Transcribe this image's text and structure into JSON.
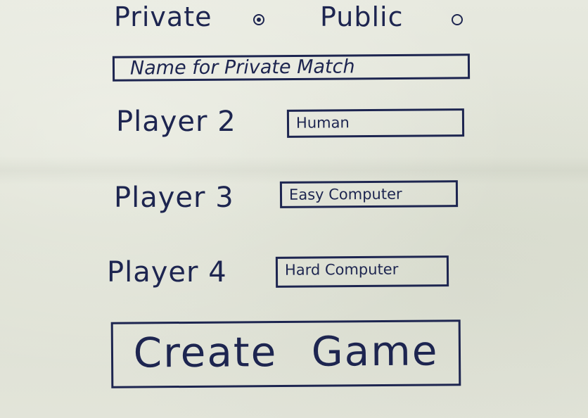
{
  "visibility": {
    "private_label": "Private",
    "public_label": "Public",
    "selected": "private"
  },
  "match_name": {
    "placeholder": "Name for Private Match"
  },
  "players": [
    {
      "label": "Player 2",
      "selection": "Human"
    },
    {
      "label": "Player 3",
      "selection": "Easy Computer"
    },
    {
      "label": "Player 4",
      "selection": "Hard Computer"
    }
  ],
  "create_button_label": "Create Game",
  "colors": {
    "ink": "#1d2550",
    "paper": "#e2e4d9"
  }
}
